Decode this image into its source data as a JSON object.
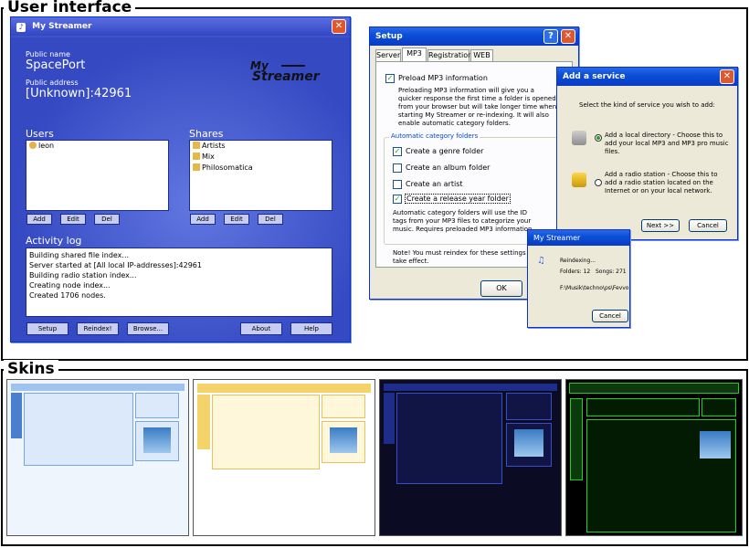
{
  "sections": {
    "ui_title": "User interface",
    "skins_title": "Skins"
  },
  "main": {
    "title": "My Streamer",
    "public_name_label": "Public name",
    "public_name": "SpacePort",
    "public_address_label": "Public address",
    "public_address": "[Unknown]:42961",
    "logo_top": "My",
    "logo_bottom": "Streamer",
    "users_label": "Users",
    "users": [
      "leon"
    ],
    "shares_label": "Shares",
    "shares": [
      "Artists",
      "Mix",
      "Philosomatica"
    ],
    "add": "Add",
    "edit": "Edit",
    "del": "Del",
    "activity_label": "Activity log",
    "log": [
      "Building shared file index...",
      "Server started at [All local IP-addresses]:42961",
      "Building radio station index...",
      "Creating node index...",
      "Created 1706 nodes."
    ],
    "buttons": {
      "setup": "Setup",
      "reindex": "Reindex!",
      "browse": "Browse...",
      "about": "About",
      "help": "Help"
    }
  },
  "setup": {
    "title": "Setup",
    "tabs": [
      "Server",
      "MP3",
      "Registration",
      "WEB"
    ],
    "preload_label": "Preload MP3 information",
    "preload_desc": "Preloading MP3 information will give you a quicker response the first time a folder is opened from your browser but will take longer time when starting My Streamer or re-indexing. It will also enable automatic category folders.",
    "auto_group": "Automatic category folders",
    "options": [
      {
        "label": "Create a genre folder",
        "checked": true
      },
      {
        "label": "Create an album folder",
        "checked": false
      },
      {
        "label": "Create an artist",
        "checked": false
      },
      {
        "label": "Create a release year folder",
        "checked": true
      }
    ],
    "id_tags_desc": "Automatic category folders will use the ID tags from your MP3 files to categorize your music. Requires preloaded MP3 information.",
    "note": "Note! You must reindex for these settings to take effect.",
    "ok": "OK"
  },
  "service": {
    "title": "Add a service",
    "prompt": "Select the kind of service you wish to add:",
    "local": "Add a local directory - Choose this to add your local MP3 and MP3 pro music files.",
    "radio": "Add a radio station - Choose this to add a radio station located on the Internet or on your local network.",
    "next": "Next >>",
    "cancel": "Cancel"
  },
  "reindex": {
    "title": "My Streamer",
    "status": "Reindexing...",
    "folders": "Folders: 12",
    "songs": "Songs: 271",
    "path": "F:\\Musik\\techno\\ps\\Fevvo",
    "cancel": "Cancel"
  },
  "colors": {
    "accent": "#3e53c8",
    "xp_title": "#0b4fd8",
    "skin_green": "#1fd11f"
  }
}
